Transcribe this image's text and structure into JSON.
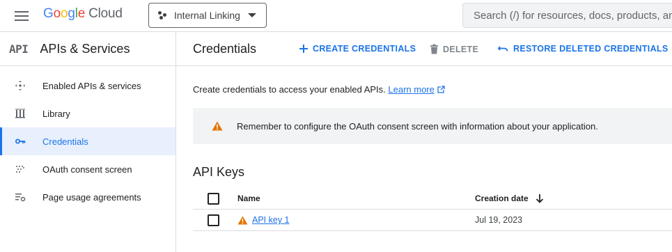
{
  "header": {
    "brand": "Cloud",
    "project": "Internal Linking",
    "search_placeholder": "Search (/) for resources, docs, products, and more"
  },
  "sidebar": {
    "badge": "API",
    "title": "APIs & Services",
    "items": [
      {
        "label": "Enabled APIs & services",
        "icon": "diamond-arrows-icon",
        "active": false
      },
      {
        "label": "Library",
        "icon": "library-icon",
        "active": false
      },
      {
        "label": "Credentials",
        "icon": "key-icon",
        "active": true
      },
      {
        "label": "OAuth consent screen",
        "icon": "dotted-consent-icon",
        "active": false
      },
      {
        "label": "Page usage agreements",
        "icon": "settings-list-icon",
        "active": false
      }
    ]
  },
  "main": {
    "title": "Credentials",
    "actions": {
      "create": "CREATE CREDENTIALS",
      "delete": "DELETE",
      "restore": "RESTORE DELETED CREDENTIALS"
    },
    "intro_text": "Create credentials to access your enabled APIs.",
    "learn_more": "Learn more",
    "banner_text": "Remember to configure the OAuth consent screen with information about your application.",
    "section_title": "API Keys",
    "table": {
      "columns": [
        "Name",
        "Creation date"
      ],
      "rows": [
        {
          "name": "API key 1",
          "date": "Jul 19, 2023"
        }
      ]
    }
  },
  "colors": {
    "accent": "#1a73e8",
    "warning": "#e37400"
  }
}
